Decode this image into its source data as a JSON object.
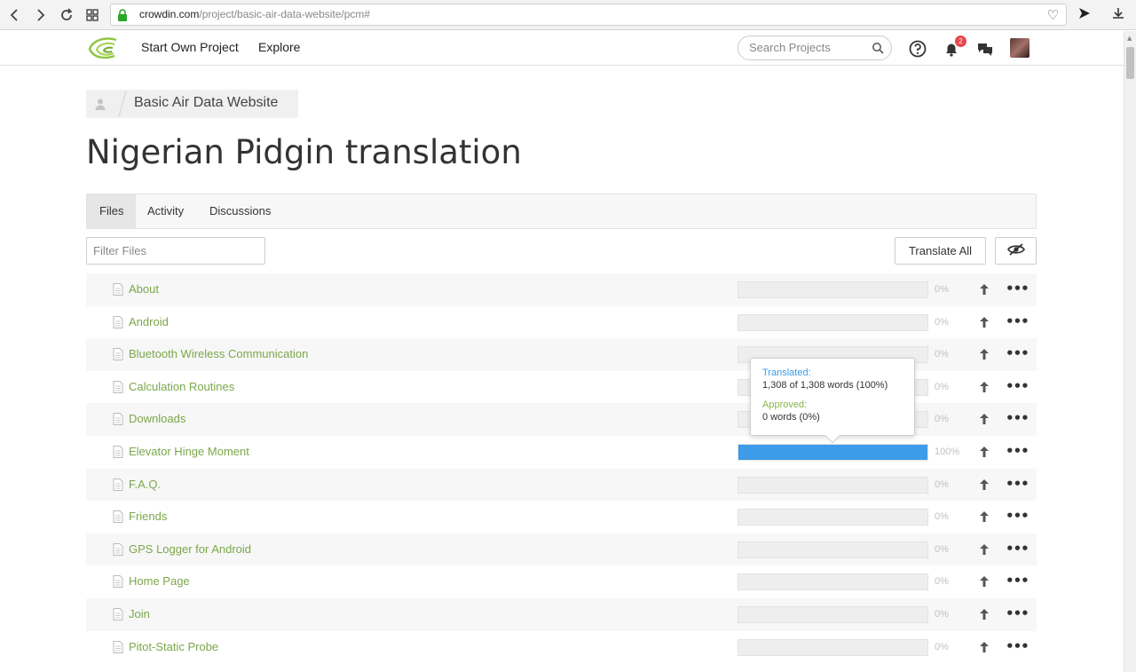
{
  "browser": {
    "url_host": "crowdin.com",
    "url_path": "/project/basic-air-data-website/pcm#"
  },
  "header": {
    "nav": [
      "Start Own Project",
      "Explore"
    ],
    "search_placeholder": "Search Projects",
    "notification_count": "2"
  },
  "breadcrumb": {
    "project": "Basic Air Data Website"
  },
  "page_title": "Nigerian Pidgin translation",
  "tabs": [
    {
      "label": "Files",
      "active": true
    },
    {
      "label": "Activity",
      "active": false
    },
    {
      "label": "Discussions",
      "active": false
    }
  ],
  "toolbar": {
    "filter_placeholder": "Filter Files",
    "translate_all": "Translate All"
  },
  "files": [
    {
      "name": "About",
      "percent": 0,
      "percent_label": "0%"
    },
    {
      "name": "Android",
      "percent": 0,
      "percent_label": "0%"
    },
    {
      "name": "Bluetooth Wireless Communication",
      "percent": 0,
      "percent_label": "0%"
    },
    {
      "name": "Calculation Routines",
      "percent": 0,
      "percent_label": "0%"
    },
    {
      "name": "Downloads",
      "percent": 0,
      "percent_label": "0%"
    },
    {
      "name": "Elevator Hinge Moment",
      "percent": 100,
      "percent_label": "100%"
    },
    {
      "name": "F.A.Q.",
      "percent": 0,
      "percent_label": "0%"
    },
    {
      "name": "Friends",
      "percent": 0,
      "percent_label": "0%"
    },
    {
      "name": "GPS Logger for Android",
      "percent": 0,
      "percent_label": "0%"
    },
    {
      "name": "Home Page",
      "percent": 0,
      "percent_label": "0%"
    },
    {
      "name": "Join",
      "percent": 0,
      "percent_label": "0%"
    },
    {
      "name": "Pitot-Static Probe",
      "percent": 0,
      "percent_label": "0%"
    }
  ],
  "tooltip": {
    "translated_label": "Translated:",
    "translated_value": "1,308 of 1,308 words (100%)",
    "approved_label": "Approved:",
    "approved_value": "0 words (0%)"
  },
  "colors": {
    "accent_green": "#7ba74a",
    "progress_blue": "#3d9be9",
    "badge_red": "#e5484d"
  }
}
